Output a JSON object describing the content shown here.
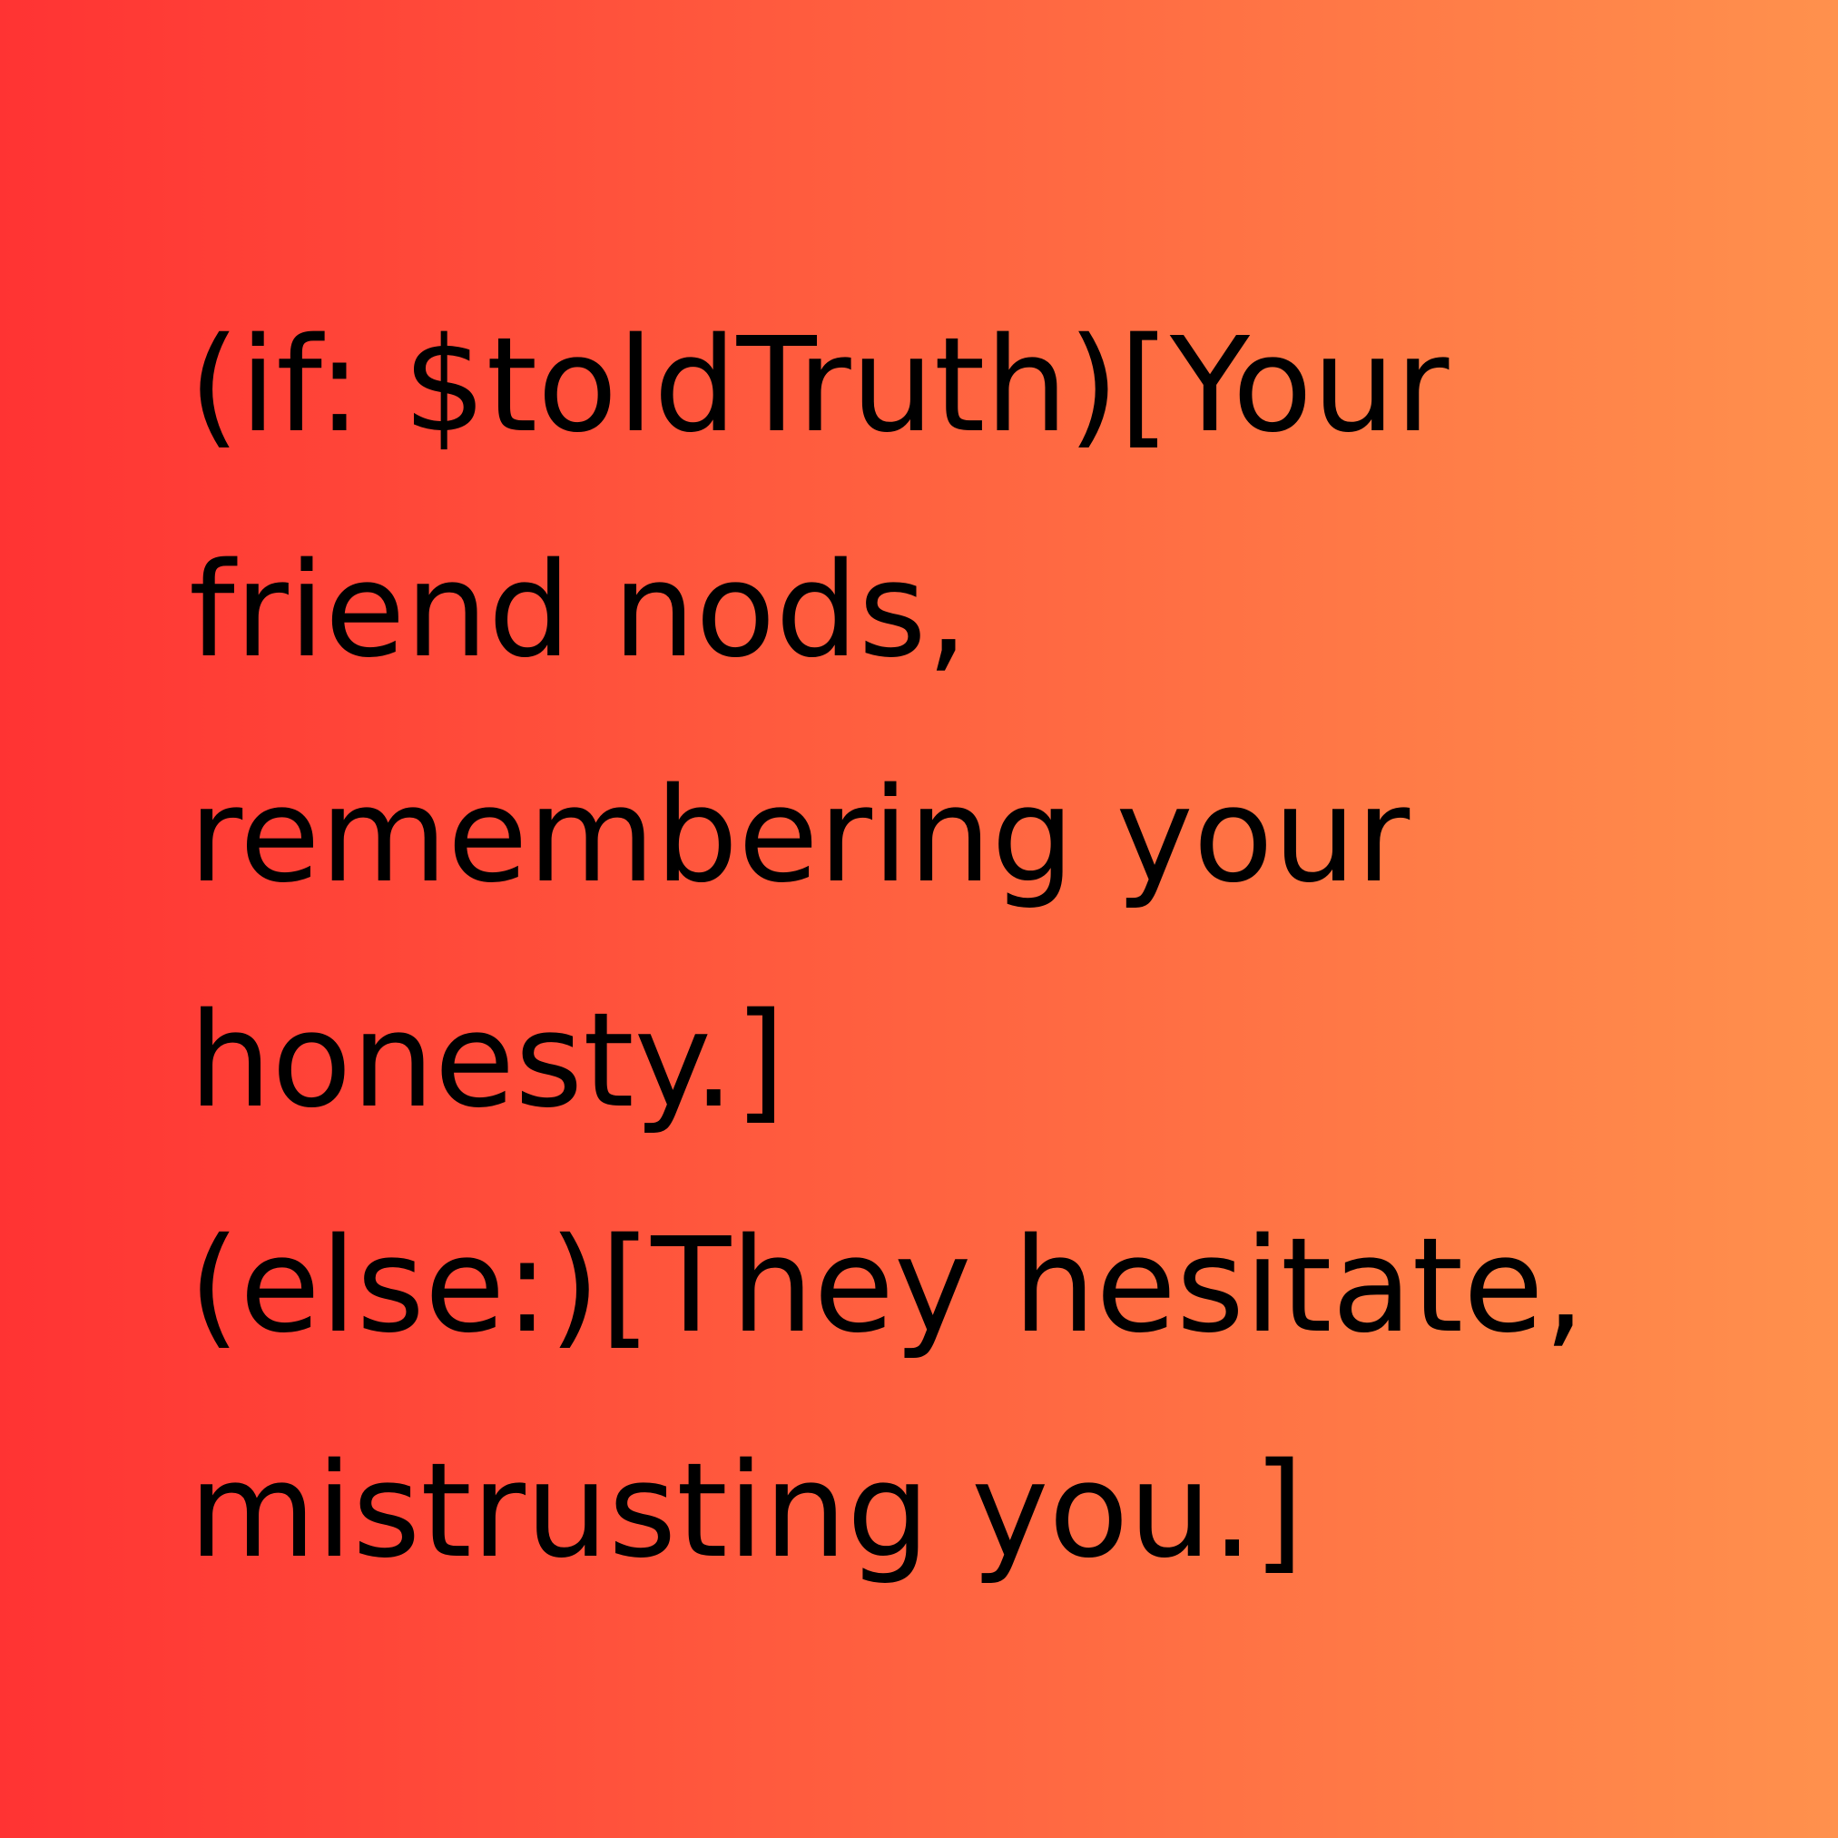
{
  "background": {
    "gradient_start": "#ff3333",
    "gradient_end": "#ff914d"
  },
  "text_color": "#000000",
  "lines": [
    "(if: $toldTruth)[Your",
    "friend nods,",
    "remembering your",
    "honesty.]",
    "(else:)[They hesitate,",
    "mistrusting you.]"
  ]
}
